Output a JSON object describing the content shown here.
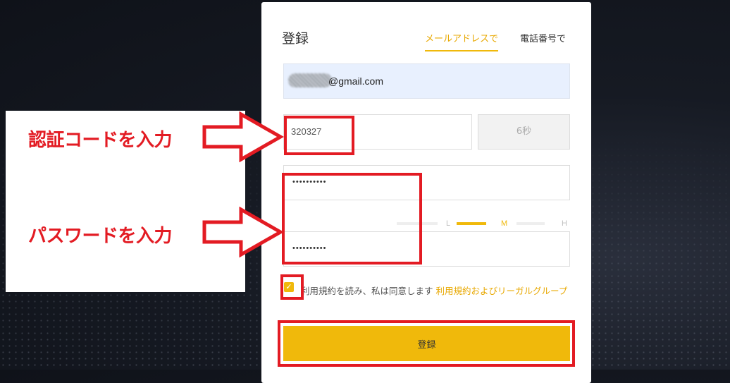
{
  "form": {
    "title": "登録",
    "tabs": [
      {
        "label": "メールアドレスで",
        "active": true
      },
      {
        "label": "電話番号で",
        "active": false
      }
    ],
    "email_suffix": "@gmail.com",
    "verification_code": "320327",
    "countdown_label": "6秒",
    "password": "••••••••••",
    "password_confirm": "••••••••••",
    "strength": {
      "low": "L",
      "medium": "M",
      "high": "H",
      "current": "M"
    },
    "terms_text": "利用規約を読み、私は同意します",
    "terms_link": "利用規約およびリーガルグループ",
    "terms_checked": true,
    "submit_label": "登録"
  },
  "annotations": {
    "code_label": "認証コードを入力",
    "password_label": "パスワードを入力",
    "color": "#e31b23"
  },
  "colors": {
    "accent": "#f0b90b",
    "background": "#161a23",
    "input_autofill": "#e8f0fe"
  }
}
